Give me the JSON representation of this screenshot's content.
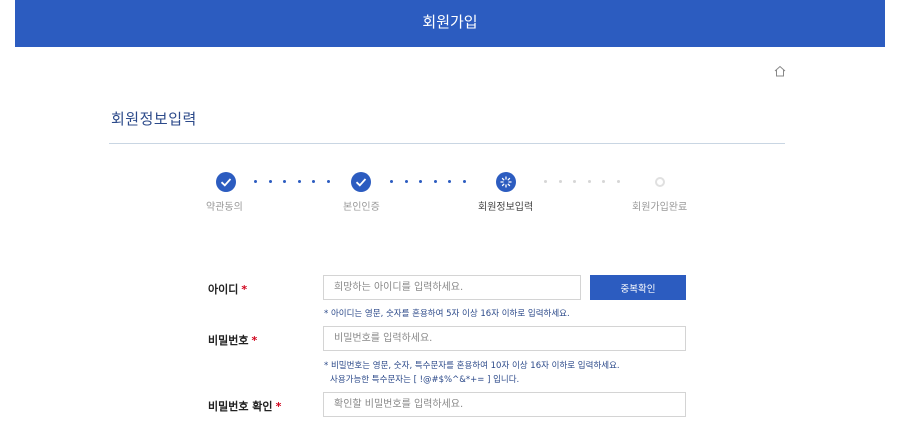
{
  "header": {
    "title": "회원가입"
  },
  "section": {
    "title": "회원정보입력"
  },
  "steps": [
    {
      "label": "약관동의",
      "state": "done"
    },
    {
      "label": "본인인증",
      "state": "done"
    },
    {
      "label": "회원정보입력",
      "state": "current"
    },
    {
      "label": "회원가입완료",
      "state": "pending"
    }
  ],
  "form": {
    "id": {
      "label": "아이디",
      "required_mark": "*",
      "placeholder": "희망하는 아이디를 입력하세요.",
      "check_button": "중복확인",
      "hint": "* 아이디는 영문, 숫자를 혼용하여 5자 이상 16자 이하로 입력하세요."
    },
    "password": {
      "label": "비밀번호",
      "required_mark": "*",
      "placeholder": "비밀번호를 입력하세요.",
      "hint_line1": "* 비밀번호는 영문, 숫자, 특수문자를 혼용하여 10자 이상 16자 이하로 입력하세요.",
      "hint_line2": "사용가능한 특수문자는 [ !@#$%^&*+= ] 입니다."
    },
    "password_confirm": {
      "label": "비밀번호 확인",
      "required_mark": "*",
      "placeholder": "확인할 비밀번호를 입력하세요."
    }
  },
  "colors": {
    "primary": "#2c5cc0",
    "required": "#d0021b",
    "divider": "#c9d6e3"
  }
}
